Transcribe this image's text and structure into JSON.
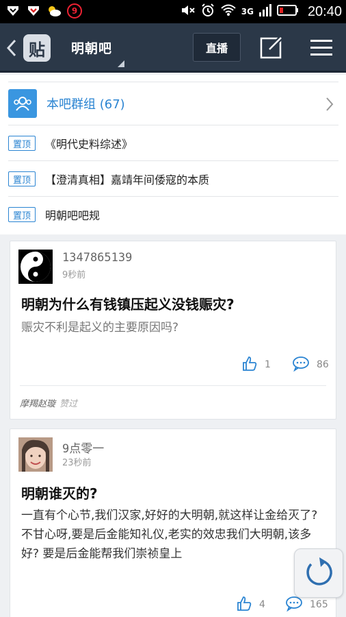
{
  "status_bar": {
    "notification_count": "9",
    "network": "3G",
    "time": "20:40"
  },
  "nav": {
    "logo_text": "贴",
    "bar_title": "明朝吧",
    "live_label": "直播"
  },
  "group_row": {
    "label": "本吧群组 (67)"
  },
  "pinned": [
    {
      "badge": "置顶",
      "title": "《明代史料综述》"
    },
    {
      "badge": "置顶",
      "title": "【澄清真相】嘉靖年间倭寇的本质"
    },
    {
      "badge": "置顶",
      "title": "明朝吧吧规"
    }
  ],
  "posts": [
    {
      "username": "1347865139",
      "time": "9秒前",
      "title": "明朝为什么有钱镇压起义没钱赈灾?",
      "body": "赈灾不利是起义的主要原因吗?",
      "likes": "1",
      "comments": "86",
      "liked_by": "摩羯赵璇",
      "liked_suffix": "赞过"
    },
    {
      "username": "9点零一",
      "time": "23秒前",
      "title": "明朝谁灭的?",
      "body": "一直有个心节,我们汉家,好好的大明朝,就这样让金给灭了?不甘心呀,要是后金能知礼仪,老实的效忠我们大明朝,该多好? 要是后金能帮我们崇祯皇上",
      "likes": "4",
      "comments": "165"
    }
  ],
  "colors": {
    "nav_bg": "#2b3848",
    "accent_blue": "#2a84d2",
    "page_bg": "#eef0f3"
  },
  "icons": [
    "back-icon",
    "tieba-logo",
    "edit-icon",
    "menu-icon",
    "group-icon",
    "chevron-right-icon",
    "thumbs-up-icon",
    "comment-icon",
    "refresh-icon"
  ]
}
